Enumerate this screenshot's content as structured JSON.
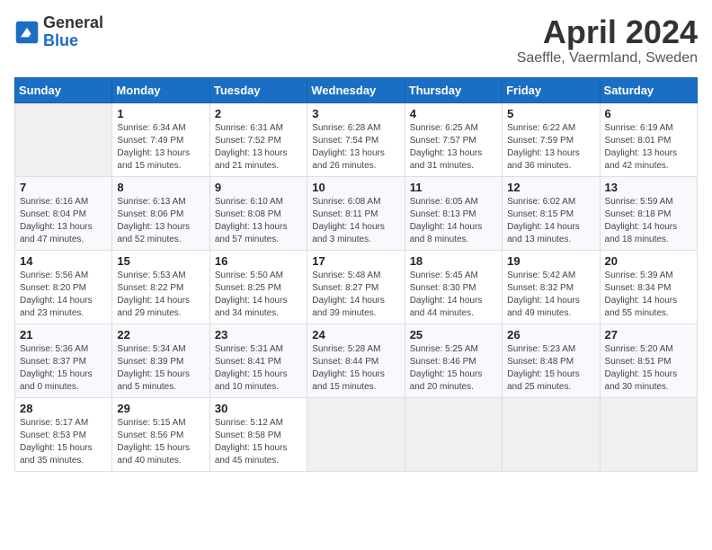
{
  "header": {
    "logo": {
      "general": "General",
      "blue": "Blue"
    },
    "title": "April 2024",
    "location": "Saeffle, Vaermland, Sweden"
  },
  "calendar": {
    "weekdays": [
      "Sunday",
      "Monday",
      "Tuesday",
      "Wednesday",
      "Thursday",
      "Friday",
      "Saturday"
    ],
    "weeks": [
      [
        {
          "day": "",
          "info": ""
        },
        {
          "day": "1",
          "info": "Sunrise: 6:34 AM\nSunset: 7:49 PM\nDaylight: 13 hours\nand 15 minutes."
        },
        {
          "day": "2",
          "info": "Sunrise: 6:31 AM\nSunset: 7:52 PM\nDaylight: 13 hours\nand 21 minutes."
        },
        {
          "day": "3",
          "info": "Sunrise: 6:28 AM\nSunset: 7:54 PM\nDaylight: 13 hours\nand 26 minutes."
        },
        {
          "day": "4",
          "info": "Sunrise: 6:25 AM\nSunset: 7:57 PM\nDaylight: 13 hours\nand 31 minutes."
        },
        {
          "day": "5",
          "info": "Sunrise: 6:22 AM\nSunset: 7:59 PM\nDaylight: 13 hours\nand 36 minutes."
        },
        {
          "day": "6",
          "info": "Sunrise: 6:19 AM\nSunset: 8:01 PM\nDaylight: 13 hours\nand 42 minutes."
        }
      ],
      [
        {
          "day": "7",
          "info": "Sunrise: 6:16 AM\nSunset: 8:04 PM\nDaylight: 13 hours\nand 47 minutes."
        },
        {
          "day": "8",
          "info": "Sunrise: 6:13 AM\nSunset: 8:06 PM\nDaylight: 13 hours\nand 52 minutes."
        },
        {
          "day": "9",
          "info": "Sunrise: 6:10 AM\nSunset: 8:08 PM\nDaylight: 13 hours\nand 57 minutes."
        },
        {
          "day": "10",
          "info": "Sunrise: 6:08 AM\nSunset: 8:11 PM\nDaylight: 14 hours\nand 3 minutes."
        },
        {
          "day": "11",
          "info": "Sunrise: 6:05 AM\nSunset: 8:13 PM\nDaylight: 14 hours\nand 8 minutes."
        },
        {
          "day": "12",
          "info": "Sunrise: 6:02 AM\nSunset: 8:15 PM\nDaylight: 14 hours\nand 13 minutes."
        },
        {
          "day": "13",
          "info": "Sunrise: 5:59 AM\nSunset: 8:18 PM\nDaylight: 14 hours\nand 18 minutes."
        }
      ],
      [
        {
          "day": "14",
          "info": "Sunrise: 5:56 AM\nSunset: 8:20 PM\nDaylight: 14 hours\nand 23 minutes."
        },
        {
          "day": "15",
          "info": "Sunrise: 5:53 AM\nSunset: 8:22 PM\nDaylight: 14 hours\nand 29 minutes."
        },
        {
          "day": "16",
          "info": "Sunrise: 5:50 AM\nSunset: 8:25 PM\nDaylight: 14 hours\nand 34 minutes."
        },
        {
          "day": "17",
          "info": "Sunrise: 5:48 AM\nSunset: 8:27 PM\nDaylight: 14 hours\nand 39 minutes."
        },
        {
          "day": "18",
          "info": "Sunrise: 5:45 AM\nSunset: 8:30 PM\nDaylight: 14 hours\nand 44 minutes."
        },
        {
          "day": "19",
          "info": "Sunrise: 5:42 AM\nSunset: 8:32 PM\nDaylight: 14 hours\nand 49 minutes."
        },
        {
          "day": "20",
          "info": "Sunrise: 5:39 AM\nSunset: 8:34 PM\nDaylight: 14 hours\nand 55 minutes."
        }
      ],
      [
        {
          "day": "21",
          "info": "Sunrise: 5:36 AM\nSunset: 8:37 PM\nDaylight: 15 hours\nand 0 minutes."
        },
        {
          "day": "22",
          "info": "Sunrise: 5:34 AM\nSunset: 8:39 PM\nDaylight: 15 hours\nand 5 minutes."
        },
        {
          "day": "23",
          "info": "Sunrise: 5:31 AM\nSunset: 8:41 PM\nDaylight: 15 hours\nand 10 minutes."
        },
        {
          "day": "24",
          "info": "Sunrise: 5:28 AM\nSunset: 8:44 PM\nDaylight: 15 hours\nand 15 minutes."
        },
        {
          "day": "25",
          "info": "Sunrise: 5:25 AM\nSunset: 8:46 PM\nDaylight: 15 hours\nand 20 minutes."
        },
        {
          "day": "26",
          "info": "Sunrise: 5:23 AM\nSunset: 8:48 PM\nDaylight: 15 hours\nand 25 minutes."
        },
        {
          "day": "27",
          "info": "Sunrise: 5:20 AM\nSunset: 8:51 PM\nDaylight: 15 hours\nand 30 minutes."
        }
      ],
      [
        {
          "day": "28",
          "info": "Sunrise: 5:17 AM\nSunset: 8:53 PM\nDaylight: 15 hours\nand 35 minutes."
        },
        {
          "day": "29",
          "info": "Sunrise: 5:15 AM\nSunset: 8:56 PM\nDaylight: 15 hours\nand 40 minutes."
        },
        {
          "day": "30",
          "info": "Sunrise: 5:12 AM\nSunset: 8:58 PM\nDaylight: 15 hours\nand 45 minutes."
        },
        {
          "day": "",
          "info": ""
        },
        {
          "day": "",
          "info": ""
        },
        {
          "day": "",
          "info": ""
        },
        {
          "day": "",
          "info": ""
        }
      ]
    ]
  }
}
